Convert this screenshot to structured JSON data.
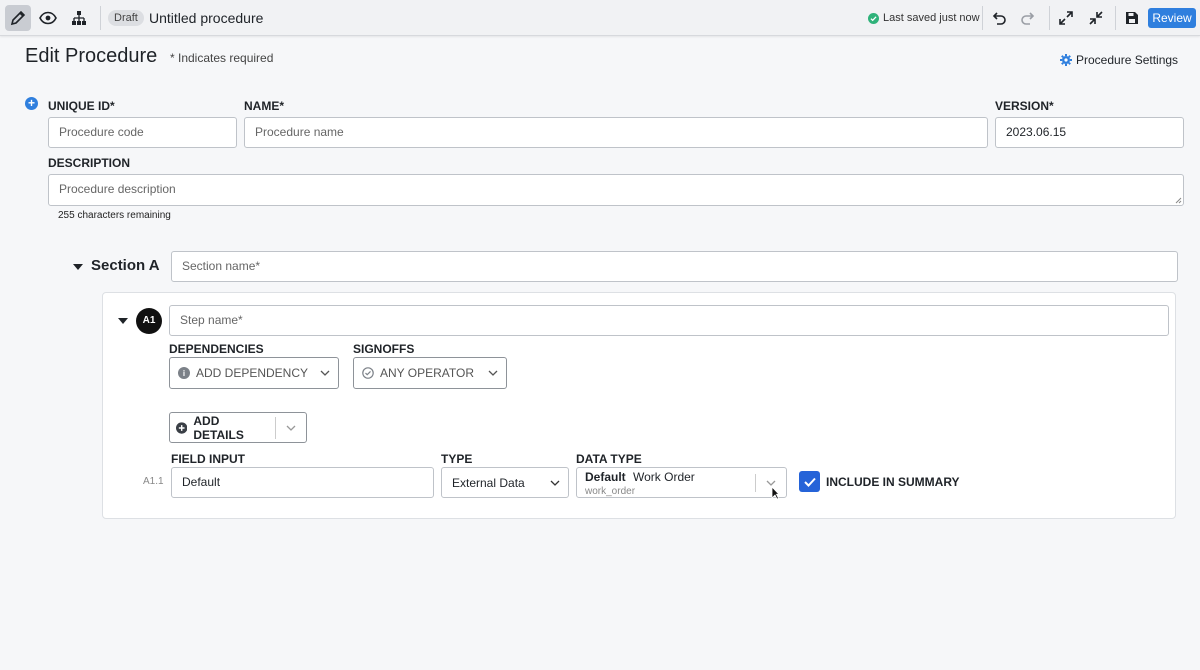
{
  "toolbar": {
    "draft_badge": "Draft",
    "title": "Untitled procedure",
    "saved_status": "Last saved just now",
    "review_label": "Review",
    "icons": [
      "pencil-icon",
      "eye-icon",
      "hierarchy-icon",
      "undo-icon",
      "redo-icon",
      "expand-icon",
      "collapse-icon",
      "save-icon"
    ]
  },
  "header": {
    "title": "Edit Procedure",
    "required_note": "* Indicates required",
    "settings_label": "Procedure Settings"
  },
  "procedure": {
    "unique_id_label": "UNIQUE ID*",
    "unique_id_placeholder": "Procedure code",
    "name_label": "NAME*",
    "name_placeholder": "Procedure name",
    "version_label": "VERSION*",
    "version_value": "2023.06.15",
    "description_label": "DESCRIPTION",
    "description_placeholder": "Procedure description",
    "chars_remaining": "255 characters remaining"
  },
  "section": {
    "title": "Section A",
    "name_placeholder": "Section name*"
  },
  "step": {
    "badge": "A1",
    "name_placeholder": "Step name*",
    "dependencies_label": "DEPENDENCIES",
    "add_dependency": "ADD DEPENDENCY",
    "signoffs_label": "SIGNOFFS",
    "any_operator": "ANY OPERATOR",
    "add_details": "ADD DETAILS",
    "field": {
      "index": "A1.1",
      "field_input_label": "FIELD INPUT",
      "field_input_value": "Default",
      "type_label": "TYPE",
      "type_value": "External Data",
      "data_type_label": "DATA TYPE",
      "data_type_bold": "Default",
      "data_type_name": "Work Order",
      "data_type_sub": "work_order",
      "include_summary_label": "INCLUDE IN SUMMARY",
      "include_summary_checked": true
    }
  },
  "colors": {
    "accent": "#2f7fde",
    "checkbox": "#2563d8",
    "saved_ok": "#2fb27a"
  }
}
